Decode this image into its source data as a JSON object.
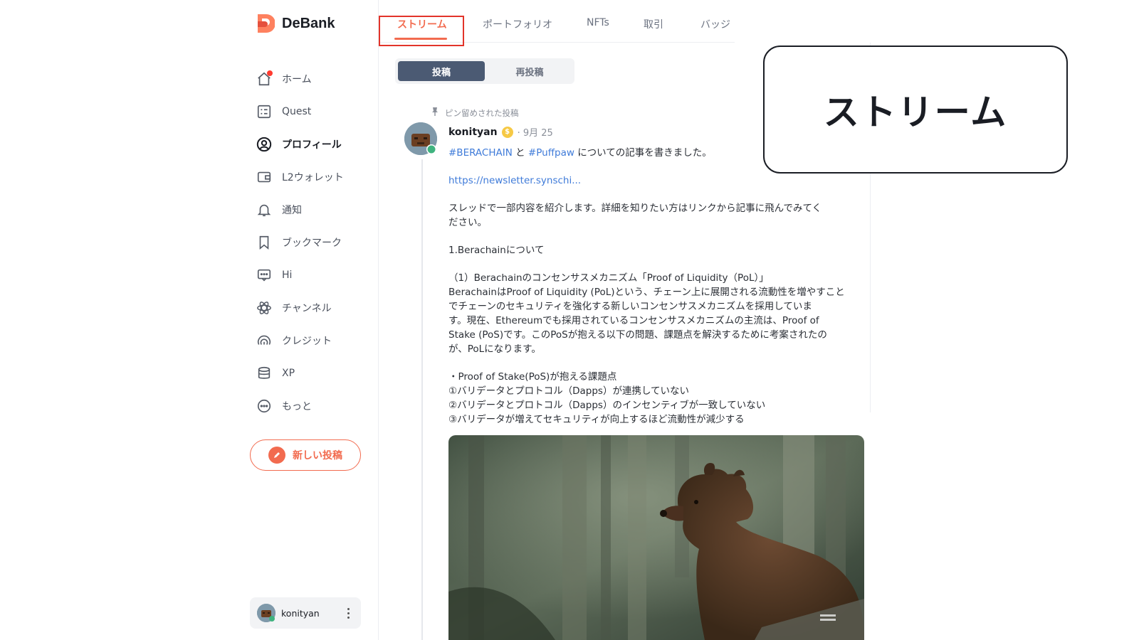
{
  "app": {
    "name": "DeBank",
    "brand_color": "#f26b4f"
  },
  "sidebar": {
    "items": [
      {
        "label": "ホーム",
        "icon": "home-icon"
      },
      {
        "label": "Quest",
        "icon": "quest-icon"
      },
      {
        "label": "プロフィール",
        "icon": "profile-icon",
        "active": true
      },
      {
        "label": "L2ウォレット",
        "icon": "wallet-icon"
      },
      {
        "label": "通知",
        "icon": "bell-icon"
      },
      {
        "label": "ブックマーク",
        "icon": "bookmark-icon"
      },
      {
        "label": "Hi",
        "icon": "chat-icon"
      },
      {
        "label": "チャンネル",
        "icon": "atom-icon"
      },
      {
        "label": "クレジット",
        "icon": "gauge-icon"
      },
      {
        "label": "XP",
        "icon": "database-icon"
      },
      {
        "label": "もっと",
        "icon": "more-icon"
      }
    ],
    "new_post_label": "新しい投稿",
    "user_name": "konityan"
  },
  "tabs": [
    {
      "label": "ストリーム",
      "active": true
    },
    {
      "label": "ポートフォリオ"
    },
    {
      "label": "NFTs"
    },
    {
      "label": "取引"
    },
    {
      "label": "バッジ"
    }
  ],
  "segmented": {
    "active": "投稿",
    "inactive": "再投稿"
  },
  "post": {
    "pinned_label": "ピン留めされた投稿",
    "author": "konityan",
    "coin_symbol": "$",
    "date": "· 9月 25",
    "intro": {
      "tag1": "#BERACHAIN",
      "and": "と",
      "tag2": "#Puffpaw",
      "rest": "についての記事を書きました。"
    },
    "link": "https://newsletter.synschi...",
    "lines": [
      "スレッドで一部内容を紹介します。詳細を知りたい方はリンクから記事に飛んでみてく",
      "ださい。",
      "1.Berachainについて",
      "（1）Berachainのコンセンサスメカニズム「Proof of Liquidity（PoL）」",
      "BerachainはProof of Liquidity (PoL)という、チェーン上に展開される流動性を増やすこと",
      "でチェーンのセキュリティを強化する新しいコンセンサスメカニズムを採用していま",
      "す。現在、Ethereumでも採用されているコンセンサスメカニズムの主流は、Proof of",
      "Stake (PoS)です。このPoSが抱える以下の問題、課題点を解決するために考案されたの",
      "が、PoLになります。",
      "・Proof of Stake(PoS)が抱える課題点",
      "①バリデータとプロトコル（Dapps）が連携していない",
      "②バリデータとプロトコル（Dapps）のインセンティブが一致していない",
      "③バリデータが増えてセキュリティが向上するほど流動性が減少する"
    ]
  },
  "callout": {
    "text": "ストリーム"
  }
}
